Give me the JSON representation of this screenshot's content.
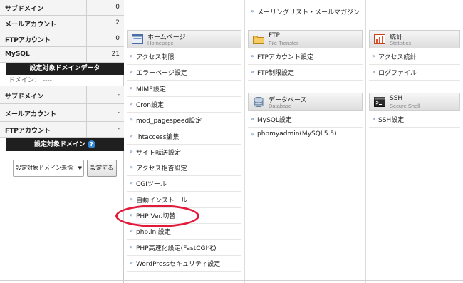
{
  "sidebar": {
    "stats": [
      {
        "label": "サブドメイン",
        "value": "0"
      },
      {
        "label": "メールアカウント",
        "value": "2"
      },
      {
        "label": "FTPアカウント",
        "value": "0"
      },
      {
        "label": "MySQL",
        "value": "21"
      }
    ],
    "domain_data_header": "設定対象ドメインデータ",
    "domain_line": "ドメイン： ----",
    "domain_stats": [
      {
        "label": "サブドメイン",
        "value": "-"
      },
      {
        "label": "メールアカウント",
        "value": "-"
      },
      {
        "label": "FTPアカウント",
        "value": "-"
      }
    ],
    "target_domain_header": "設定対象ドメイン",
    "help_glyph": "?",
    "domain_select_value": "設定対象ドメイン未指",
    "set_button": "設定する"
  },
  "top_item": "メーリングリスト・メールマガジン",
  "sections": {
    "homepage": {
      "title": "ホームページ",
      "subtitle": "Homepage",
      "icon": "homepage-icon",
      "items": [
        "アクセス制限",
        "エラーページ設定",
        "MIME設定",
        "Cron設定",
        "mod_pagespeed設定",
        ".htaccess編集",
        "サイト転送設定",
        "アクセス拒否設定",
        "CGIツール",
        "自動インストール",
        "PHP Ver.切替",
        "php.ini設定",
        "PHP高速化設定(FastCGI化)",
        "WordPressセキュリティ設定"
      ]
    },
    "ftp": {
      "title": "FTP",
      "subtitle": "File Transfer",
      "icon": "folder-icon",
      "items": [
        "FTPアカウント設定",
        "FTP制限設定"
      ]
    },
    "database": {
      "title": "データベース",
      "subtitle": "Database",
      "icon": "database-icon",
      "items": [
        "MySQL設定",
        "phpmyadmin(MySQL5.5)"
      ]
    },
    "stats": {
      "title": "統計",
      "subtitle": "Statistics",
      "icon": "chart-icon",
      "items": [
        "アクセス統計",
        "ログファイル"
      ]
    },
    "ssh": {
      "title": "SSH",
      "subtitle": "Secure Shell",
      "icon": "terminal-icon",
      "items": [
        "SSH設定"
      ]
    }
  },
  "arrow_glyph": "»",
  "colors": {
    "highlight": "#e41a3b",
    "header_bg": "#1f1f1f",
    "help": "#2f86d6"
  }
}
